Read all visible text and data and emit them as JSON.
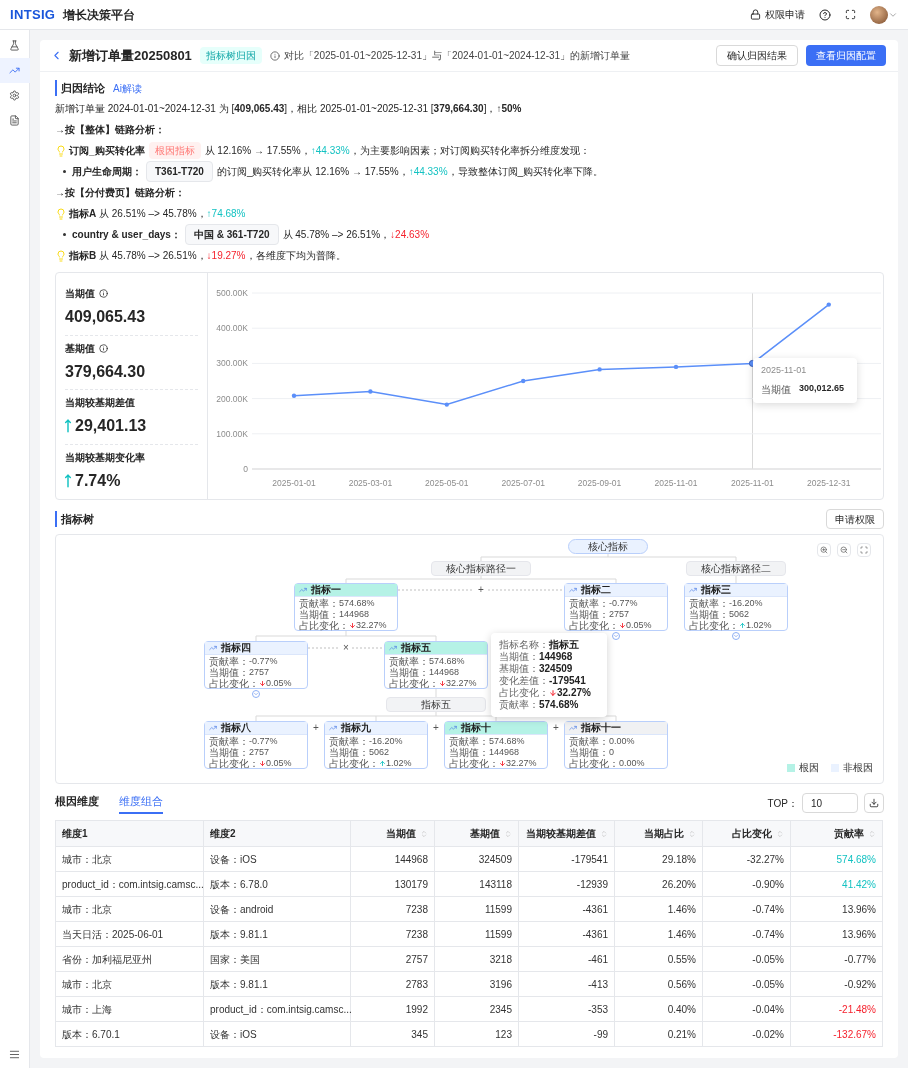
{
  "header": {
    "logo": "INTSIG",
    "app_title": "增长决策平台",
    "permission_link": "权限申请"
  },
  "sidebar": {
    "items": [
      {
        "kind": "flask",
        "selected": false
      },
      {
        "kind": "trend",
        "selected": true
      },
      {
        "kind": "settings",
        "selected": false
      },
      {
        "kind": "document",
        "selected": false
      }
    ]
  },
  "page": {
    "title": "新增订单量20250801",
    "tag": "指标树归因",
    "compare_note": "对比「2025-01-01~2025-12-31」与「2024-01-01~2024-12-31」的新增订单量",
    "buttons": [
      {
        "label": "确认归因结果",
        "kind": "secondary"
      },
      {
        "label": "查看归因配置",
        "kind": "primary"
      }
    ]
  },
  "conclusion": {
    "title": "归因结论",
    "ai_link": "Ai解读",
    "lines": [
      {
        "kind": "plain",
        "segments": [
          {
            "kind": "text",
            "text": "新增订单量 2024-01-01~2024-12-31 为 [**409,065.43**]，相比 2025-01-01~2025-12-31 [**379,664.30**]，**↑50%**"
          }
        ]
      },
      {
        "kind": "heading",
        "segments": [
          {
            "kind": "text",
            "text": "→按【整体】链路分析："
          }
        ]
      },
      {
        "kind": "insight",
        "segments": [
          {
            "kind": "text",
            "text": "**订阅_购买转化率**"
          },
          {
            "kind": "tag",
            "text": "根因指标"
          },
          {
            "kind": "text",
            "text": "从 12.16% → 17.55%，"
          },
          {
            "kind": "up",
            "text": "↑44.33%"
          },
          {
            "kind": "text",
            "text": "，为主要影响因素；对订阅购买转化率拆分维度发现："
          }
        ]
      },
      {
        "kind": "detail",
        "segments": [
          {
            "kind": "text",
            "text": "**用户生命周期：**"
          },
          {
            "kind": "chip",
            "text": "T361-T720"
          },
          {
            "kind": "text",
            "text": "的订阅_购买转化率从 12.16% → 17.55%，"
          },
          {
            "kind": "up",
            "text": "↑44.33%"
          },
          {
            "kind": "text",
            "text": "，导致整体订阅_购买转化率下降。"
          }
        ]
      },
      {
        "kind": "heading",
        "segments": [
          {
            "kind": "text",
            "text": "→按【分付费页】链路分析："
          }
        ]
      },
      {
        "kind": "insight",
        "segments": [
          {
            "kind": "text",
            "text": "**指标A** 从 26.51% –> 45.78%，"
          },
          {
            "kind": "up",
            "text": "↑74.68%"
          }
        ]
      },
      {
        "kind": "detail",
        "segments": [
          {
            "kind": "text",
            "text": "**country & user_days：**"
          },
          {
            "kind": "chip",
            "text": "中国 & 361-T720"
          },
          {
            "kind": "text",
            "text": "从 45.78% –> 26.51%，"
          },
          {
            "kind": "down",
            "text": "↓24.63%"
          }
        ]
      },
      {
        "kind": "insight",
        "segments": [
          {
            "kind": "text",
            "text": "**指标B** 从 45.78% –> 26.51%，"
          },
          {
            "kind": "down",
            "text": "↓19.27%"
          },
          {
            "kind": "text",
            "text": "，各维度下均为普降。"
          }
        ]
      }
    ]
  },
  "metrics": [
    {
      "label": "当期值",
      "info": true,
      "value": "409,065.43",
      "kind": "plain"
    },
    {
      "label": "基期值",
      "info": true,
      "value": "379,664.30",
      "kind": "plain"
    },
    {
      "label": "当期较基期差值",
      "info": false,
      "value": "29,401.13",
      "kind": "increase"
    },
    {
      "label": "当期较基期变化率",
      "info": false,
      "value": "7.74%",
      "kind": "increase"
    }
  ],
  "trend_chart": {
    "chart_data": {
      "type": "line",
      "grid": true,
      "categories": [
        "2025-01-01",
        "2025-03-01",
        "2025-05-01",
        "2025-07-01",
        "2025-09-01",
        "2025-11-01",
        "2025-11-01",
        "2025-12-31"
      ],
      "series": [
        {
          "name": "当期值",
          "color": "#5b8ff9",
          "values": [
            208000,
            220000,
            183000,
            250000,
            283000,
            290000,
            300000,
            467000
          ]
        }
      ],
      "ylim": [
        0,
        500000
      ],
      "yticks": [
        {
          "value": 0,
          "label": "0"
        },
        {
          "value": 100000,
          "label": "100.00K"
        },
        {
          "value": 200000,
          "label": "200.00K"
        },
        {
          "value": 300000,
          "label": "300.00K"
        },
        {
          "value": 400000,
          "label": "400.00K"
        },
        {
          "value": 500000,
          "label": "500.00K"
        }
      ]
    },
    "tooltip": {
      "date": "2025-11-01",
      "value": "300,012.65"
    }
  },
  "tree": {
    "title": "指标树",
    "button": "申请权限",
    "nodes": [
      {
        "kind": "root",
        "title": "核心指标"
      },
      {
        "kind": "group",
        "title": "核心指标路径一"
      },
      {
        "kind": "group",
        "title": "核心指标路径二"
      },
      {
        "kind": "metric",
        "color": "#b5f2e6",
        "title": "指标一",
        "expandable": false,
        "stats": [
          {
            "label": "贡献率：",
            "value": "574.68%",
            "kind": "plain"
          },
          {
            "label": "当期值：",
            "value": "144968",
            "kind": "plain"
          },
          {
            "label": "占比变化：",
            "value": "32.27%",
            "kind": "down"
          }
        ]
      },
      {
        "kind": "metric",
        "color": "#eaf2ff",
        "title": "指标二",
        "expandable": true,
        "stats": [
          {
            "label": "贡献率：",
            "value": "-0.77%",
            "kind": "plain"
          },
          {
            "label": "当期值：",
            "value": "2757",
            "kind": "plain"
          },
          {
            "label": "占比变化：",
            "value": "0.05%",
            "kind": "down"
          }
        ]
      },
      {
        "kind": "metric",
        "color": "#eaf2ff",
        "title": "指标三",
        "expandable": true,
        "stats": [
          {
            "label": "贡献率：",
            "value": "-16.20%",
            "kind": "plain"
          },
          {
            "label": "当期值：",
            "value": "5062",
            "kind": "plain"
          },
          {
            "label": "占比变化：",
            "value": "1.02%",
            "kind": "up"
          }
        ]
      },
      {
        "kind": "metric",
        "color": "#eaf2ff",
        "title": "指标四",
        "expandable": true,
        "stats": [
          {
            "label": "贡献率：",
            "value": "-0.77%",
            "kind": "plain"
          },
          {
            "label": "当期值：",
            "value": "2757",
            "kind": "plain"
          },
          {
            "label": "占比变化：",
            "value": "0.05%",
            "kind": "down"
          }
        ]
      },
      {
        "kind": "metric",
        "color": "#b5f2e6",
        "title": "指标五",
        "expandable": false,
        "stats": [
          {
            "label": "贡献率：",
            "value": "574.68%",
            "kind": "plain"
          },
          {
            "label": "当期值：",
            "value": "144968",
            "kind": "plain"
          },
          {
            "label": "占比变化：",
            "value": "32.27%",
            "kind": "down"
          }
        ]
      },
      {
        "kind": "group",
        "title": "指标五"
      },
      {
        "kind": "metric",
        "color": "#eaf2ff",
        "title": "指标八",
        "expandable": false,
        "stats": [
          {
            "label": "贡献率：",
            "value": "-0.77%",
            "kind": "plain"
          },
          {
            "label": "当期值：",
            "value": "2757",
            "kind": "plain"
          },
          {
            "label": "占比变化：",
            "value": "0.05%",
            "kind": "down"
          }
        ]
      },
      {
        "kind": "metric",
        "color": "#eaf2ff",
        "title": "指标九",
        "expandable": false,
        "stats": [
          {
            "label": "贡献率：",
            "value": "-16.20%",
            "kind": "plain"
          },
          {
            "label": "当期值：",
            "value": "5062",
            "kind": "plain"
          },
          {
            "label": "占比变化：",
            "value": "1.02%",
            "kind": "up"
          }
        ]
      },
      {
        "kind": "metric",
        "color": "#b5f2e6",
        "title": "指标十",
        "expandable": false,
        "stats": [
          {
            "label": "贡献率：",
            "value": "574.68%",
            "kind": "plain"
          },
          {
            "label": "当期值：",
            "value": "144968",
            "kind": "plain"
          },
          {
            "label": "占比变化：",
            "value": "32.27%",
            "kind": "down"
          }
        ]
      },
      {
        "kind": "metric",
        "color": "#f0f1f3",
        "title": "指标十一",
        "expandable": false,
        "stats": [
          {
            "label": "贡献率：",
            "value": "0.00%",
            "kind": "plain"
          },
          {
            "label": "当期值：",
            "value": "0",
            "kind": "plain"
          },
          {
            "label": "占比变化：",
            "value": "0.00%",
            "kind": "plain"
          }
        ]
      }
    ],
    "operators": [
      "+",
      "×",
      "+",
      "+",
      "+"
    ],
    "tooltip": {
      "rows": [
        {
          "label": "指标名称：",
          "value": "指标五",
          "kind": "plain"
        },
        {
          "label": "当期值：",
          "value": "144968",
          "kind": "plain"
        },
        {
          "label": "基期值：",
          "value": "324509",
          "kind": "plain"
        },
        {
          "label": "变化差值：",
          "value": "-179541",
          "kind": "plain"
        },
        {
          "label": "占比变化：",
          "value": "32.27%",
          "kind": "down"
        },
        {
          "label": "贡献率：",
          "value": "574.68%",
          "kind": "plain"
        }
      ]
    },
    "legend": [
      {
        "label": "根因",
        "color": "#b5f2e6"
      },
      {
        "label": "非根因",
        "color": "#eaf2ff"
      }
    ]
  },
  "dimension_table": {
    "tabs": [
      {
        "label": "根因维度",
        "selected": false
      },
      {
        "label": "维度组合",
        "selected": true
      }
    ],
    "top_label": "TOP：",
    "top_value": "10",
    "columns": [
      {
        "label": "维度1",
        "sortable": false
      },
      {
        "label": "维度2",
        "sortable": false
      },
      {
        "label": "当期值",
        "sortable": true
      },
      {
        "label": "基期值",
        "sortable": true
      },
      {
        "label": "当期较基期差值",
        "sortable": true
      },
      {
        "label": "当期占比",
        "sortable": true
      },
      {
        "label": "占比变化",
        "sortable": true
      },
      {
        "label": "贡献率",
        "sortable": true
      }
    ],
    "rows": [
      {
        "kind": "positive",
        "cells": [
          "城市：北京",
          "设备：iOS",
          "144968",
          "324509",
          "-179541",
          "29.18%",
          "-32.27%",
          "574.68%"
        ]
      },
      {
        "kind": "positive",
        "cells": [
          "product_id：com.intsig.camsc...",
          "版本：6.78.0",
          "130179",
          "143118",
          "-12939",
          "26.20%",
          "-0.90%",
          "41.42%"
        ]
      },
      {
        "kind": "plain",
        "cells": [
          "城市：北京",
          "设备：android",
          "7238",
          "11599",
          "-4361",
          "1.46%",
          "-0.74%",
          "13.96%"
        ]
      },
      {
        "kind": "plain",
        "cells": [
          "当天日活：2025-06-01",
          "版本：9.81.1",
          "7238",
          "11599",
          "-4361",
          "1.46%",
          "-0.74%",
          "13.96%"
        ]
      },
      {
        "kind": "plain",
        "cells": [
          "省份：加利福尼亚州",
          "国家：美国",
          "2757",
          "3218",
          "-461",
          "0.55%",
          "-0.05%",
          "-0.77%"
        ]
      },
      {
        "kind": "plain",
        "cells": [
          "城市：北京",
          "版本：9.81.1",
          "2783",
          "3196",
          "-413",
          "0.56%",
          "-0.05%",
          "-0.92%"
        ]
      },
      {
        "kind": "negative",
        "cells": [
          "城市：上海",
          "product_id：com.intsig.camsc...",
          "1992",
          "2345",
          "-353",
          "0.40%",
          "-0.04%",
          "-21.48%"
        ]
      },
      {
        "kind": "negative",
        "cells": [
          "版本：6.70.1",
          "设备：iOS",
          "345",
          "123",
          "-99",
          "0.21%",
          "-0.02%",
          "-132.67%"
        ]
      }
    ]
  }
}
